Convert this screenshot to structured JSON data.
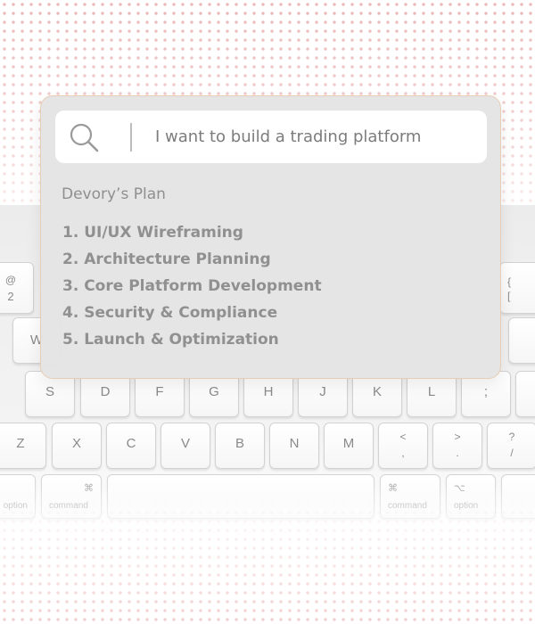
{
  "search": {
    "query": "I want to build a trading platform",
    "icon": "search-icon"
  },
  "plan": {
    "title": "Devory’s Plan",
    "steps": [
      "1. UI/UX Wireframing",
      "2. Architecture Planning",
      "3. Core Platform Development",
      "4. Security & Compliance",
      "5. Launch & Optimization"
    ]
  },
  "keyboard": {
    "row1": [
      "@",
      "2"
    ],
    "row1_right": [
      "{",
      "["
    ],
    "row2": [
      "W"
    ],
    "home_row": [
      "S",
      "D",
      "F",
      "G",
      "H",
      "J",
      "K",
      "L",
      ";"
    ],
    "bottom_row": [
      "Z",
      "X",
      "C",
      "V",
      "B",
      "N",
      "M"
    ],
    "bottom_punct": [
      [
        "<",
        ","
      ],
      [
        ">",
        "."
      ],
      [
        "?",
        "/"
      ]
    ],
    "modifiers": {
      "cmd_symbol": "⌘",
      "option_symbol": "⌥",
      "command_label": "command",
      "option_label": "option",
      "left_edge_label": "option"
    }
  },
  "colors": {
    "dot_accent": "#e6a4a4",
    "panel_bg": "#e4e4e4",
    "panel_border": "#e6cdb3",
    "text_muted": "#909090"
  }
}
